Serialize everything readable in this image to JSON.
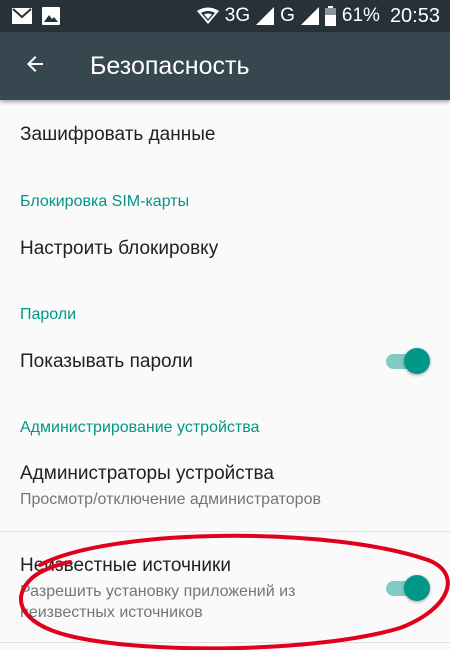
{
  "status_bar": {
    "network": "3G",
    "network2": "G",
    "battery": "61%",
    "time": "20:53",
    "icons": [
      "mail-icon",
      "image-icon",
      "wifi-icon",
      "signal-icon",
      "signal-icon",
      "battery-icon"
    ]
  },
  "app_bar": {
    "title": "Безопасность",
    "back_icon": "arrow-back-icon"
  },
  "preferences": {
    "encrypt": {
      "title": "Зашифровать данные"
    },
    "sim_category": "Блокировка SIM-карты",
    "sim_lock": {
      "title": "Настроить блокировку"
    },
    "passwords_category": "Пароли",
    "show_passwords": {
      "title": "Показывать пароли",
      "enabled": true
    },
    "admin_category": "Администрирование устройства",
    "device_admins": {
      "title": "Администраторы устройства",
      "summary": "Просмотр/отключение администраторов"
    },
    "unknown_sources": {
      "title": "Неизвестные источники",
      "summary_line1": "Разрешить установку приложений из",
      "summary_line2": "неизвестных источников",
      "enabled": true
    }
  },
  "colors": {
    "accent": "#009688",
    "status_bar": "#263238",
    "app_bar": "#37474f",
    "annotation": "#e0001b"
  }
}
